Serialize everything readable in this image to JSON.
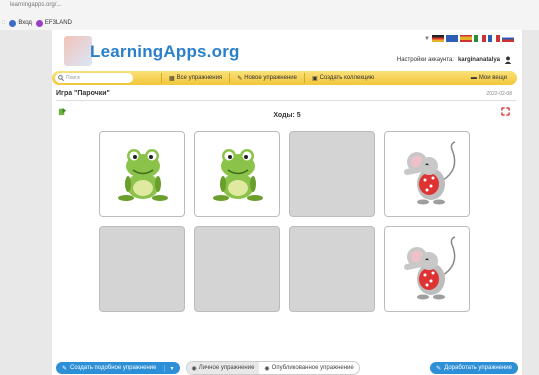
{
  "browser": {
    "url_fragment": "learningapps.org/...",
    "bookmarks": [
      {
        "label": "Вход",
        "icon": "login-icon",
        "color": "#3b6bc7"
      },
      {
        "label": "EF3LAND",
        "icon": "app-icon",
        "color": "#9b3fc7"
      }
    ]
  },
  "header": {
    "logo_text": "LearningApps.org",
    "account_label": "Настройки аккаунта:",
    "account_user": "karginanatalya",
    "flags": [
      "#d33",
      "#2b5fb8",
      "#e4b22a",
      "#2a8a3a",
      "#c33",
      "#8a4fd0"
    ]
  },
  "nav": {
    "search_placeholder": "Поиск",
    "items": [
      {
        "label": "Все упражнения",
        "icon": "grid-icon"
      },
      {
        "label": "Новое упражнение",
        "icon": "pencil-icon"
      },
      {
        "label": "Создать коллекцию",
        "icon": "collection-icon"
      }
    ],
    "my_stuff": "Мои вещи"
  },
  "game": {
    "title": "Игра \"Парочки\"",
    "date": "2022-02-08",
    "moves_label": "Ходы: 5",
    "cards": [
      {
        "state": "open",
        "image": "frog"
      },
      {
        "state": "open",
        "image": "frog"
      },
      {
        "state": "hidden",
        "image": ""
      },
      {
        "state": "open",
        "image": "mouse"
      },
      {
        "state": "hidden",
        "image": ""
      },
      {
        "state": "hidden",
        "image": ""
      },
      {
        "state": "hidden",
        "image": ""
      },
      {
        "state": "open",
        "image": "mouse"
      }
    ]
  },
  "footer": {
    "create_similar": "Создать подобное упражнение",
    "private_label": "Личное упражнение",
    "public_label": "Опубликованное упражнение",
    "improve": "Доработать упражнение"
  },
  "colors": {
    "accent": "#2d8fd6",
    "nav_yellow": "#f1c63a"
  }
}
